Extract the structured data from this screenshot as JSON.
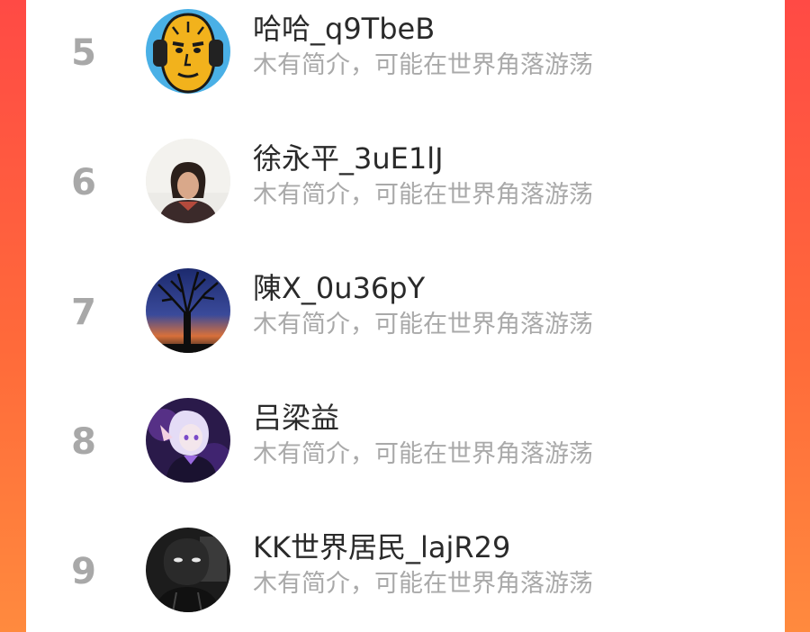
{
  "ranking": {
    "items": [
      {
        "rank": "5",
        "name": "哈哈_q9TbeB",
        "bio": "木有简介，可能在世界角落游荡"
      },
      {
        "rank": "6",
        "name": "徐永平_3uE1lJ",
        "bio": "木有简介，可能在世界角落游荡"
      },
      {
        "rank": "7",
        "name": "陳X_0u36pY",
        "bio": "木有简介，可能在世界角落游荡"
      },
      {
        "rank": "8",
        "name": "吕梁益",
        "bio": "木有简介，可能在世界角落游荡"
      },
      {
        "rank": "9",
        "name": "KK世界居民_lajR29",
        "bio": "木有简介，可能在世界角落游荡"
      }
    ]
  },
  "colors": {
    "background_accent": "#ff5a40",
    "rank_number": "#a8a8a8",
    "name_text": "#2a2a2a",
    "bio_text": "#a9a9a9"
  }
}
